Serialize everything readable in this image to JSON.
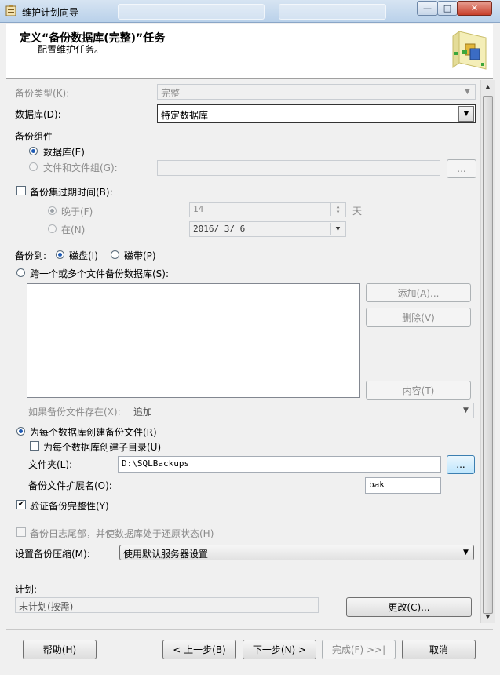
{
  "window": {
    "title": "维护计划向导",
    "controls": {
      "minimize": "—",
      "maximize": "□",
      "close": "✕"
    }
  },
  "header": {
    "title": "定义“备份数据库(完整)”任务",
    "subtitle": "配置维护任务。"
  },
  "form": {
    "backup_type": {
      "label": "备份类型(K):",
      "value": "完整"
    },
    "database": {
      "label": "数据库(D):",
      "value": "特定数据库"
    },
    "backup_component": {
      "label": "备份组件",
      "database_option": "数据库(E)",
      "files_option": "文件和文件组(G):",
      "files_browse": "..."
    },
    "expire": {
      "label": "备份集过期时间(B):",
      "after_label": "晚于(F)",
      "after_value": "14",
      "days_unit": "天",
      "on_label": "在(N)",
      "on_value": "2016/ 3/ 6"
    },
    "backup_to": {
      "label": "备份到:",
      "disk": "磁盘(I)",
      "tape": "磁带(P)"
    },
    "span_files": {
      "label": "跨一个或多个文件备份数据库(S):",
      "add": "添加(A)...",
      "remove": "删除(V)",
      "contents": "内容(T)"
    },
    "if_exists": {
      "label": "如果备份文件存在(X):",
      "value": "追加"
    },
    "per_database": {
      "label": "为每个数据库创建备份文件(R)",
      "subdir_label": "为每个数据库创建子目录(U)",
      "folder_label": "文件夹(L):",
      "folder_value": "D:\\SQLBackups",
      "folder_browse": "...",
      "ext_label": "备份文件扩展名(O):",
      "ext_value": "bak"
    },
    "verify": {
      "label": "验证备份完整性(Y)"
    },
    "tail_log": {
      "label": "备份日志尾部，并使数据库处于还原状态(H)"
    },
    "compression": {
      "label": "设置备份压缩(M):",
      "value": "使用默认服务器设置"
    },
    "schedule": {
      "label": "计划:",
      "value": "未计划(按需)",
      "change": "更改(C)..."
    }
  },
  "footer": {
    "help": "帮助(H)",
    "back": "< 上一步(B)",
    "next": "下一步(N) >",
    "finish": "完成(F) >>|",
    "cancel": "取消"
  },
  "colors": {
    "accent": "#1e5ab4",
    "titlebar": "#c9dbef"
  }
}
